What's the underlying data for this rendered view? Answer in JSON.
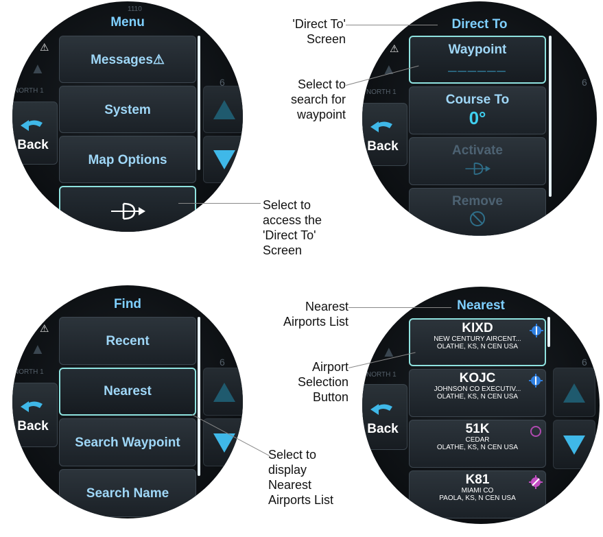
{
  "panels": {
    "menu": {
      "title": "Menu",
      "buttons": [
        "Messages⚠",
        "System",
        "Map Options"
      ],
      "direct_to_glyph": "-D▸",
      "back": "Back",
      "map_north": "NORTH 1",
      "map_num": "6",
      "map_top": "1110"
    },
    "direct": {
      "title": "Direct To",
      "waypoint_label": "Waypoint",
      "waypoint_value": "______",
      "course_label": "Course To",
      "course_value": "0°",
      "activate_label": "Activate",
      "remove_label": "Remove",
      "back": "Back",
      "map_north": "NORTH 1",
      "map_num": "6"
    },
    "find": {
      "title": "Find",
      "buttons": [
        "Recent",
        "Nearest",
        "Search Waypoint",
        "Search Name"
      ],
      "back": "Back",
      "map_north": "NORTH 1",
      "map_num": "6"
    },
    "nearest": {
      "title": "Nearest",
      "back": "Back",
      "map_north": "NORTH 1",
      "map_num": "6",
      "airports": [
        {
          "id": "KIXD",
          "name": "NEW CENTURY AIRCENT...",
          "loc": "OLATHE, KS, N CEN USA",
          "symbol": "towered"
        },
        {
          "id": "KOJC",
          "name": "JOHNSON CO EXECUTIV...",
          "loc": "OLATHE, KS, N CEN USA",
          "symbol": "towered"
        },
        {
          "id": "51K",
          "name": "CEDAR",
          "loc": "OLATHE, KS, N CEN USA",
          "symbol": "private"
        },
        {
          "id": "K81",
          "name": "MIAMI CO",
          "loc": "PAOLA, KS, N CEN USA",
          "symbol": "untowered"
        }
      ]
    }
  },
  "callouts": {
    "direct_screen": "'Direct To'\nScreen",
    "select_waypoint": "Select to\nsearch for\nwaypoint",
    "select_direct": "Select to\naccess the\n'Direct To'\nScreen",
    "nearest_list": "Nearest\nAirports List",
    "airport_button": "Airport\nSelection\nButton",
    "select_nearest": "Select to\ndisplay\nNearest\nAirports List"
  },
  "colors": {
    "title": "#7fd0ff",
    "label": "#9fd7f7",
    "select_border": "#8fe3e0",
    "arrow": "#3fb8e8",
    "towered": "#2f7fe0",
    "private": "#b04ab0",
    "untowered": "#c24dc2"
  },
  "icons": {
    "back": "back-arrow-icon",
    "up": "up-arrow-icon",
    "down": "down-arrow-icon",
    "warning": "warning-icon",
    "direct_to": "direct-to-icon",
    "remove": "remove-icon"
  }
}
